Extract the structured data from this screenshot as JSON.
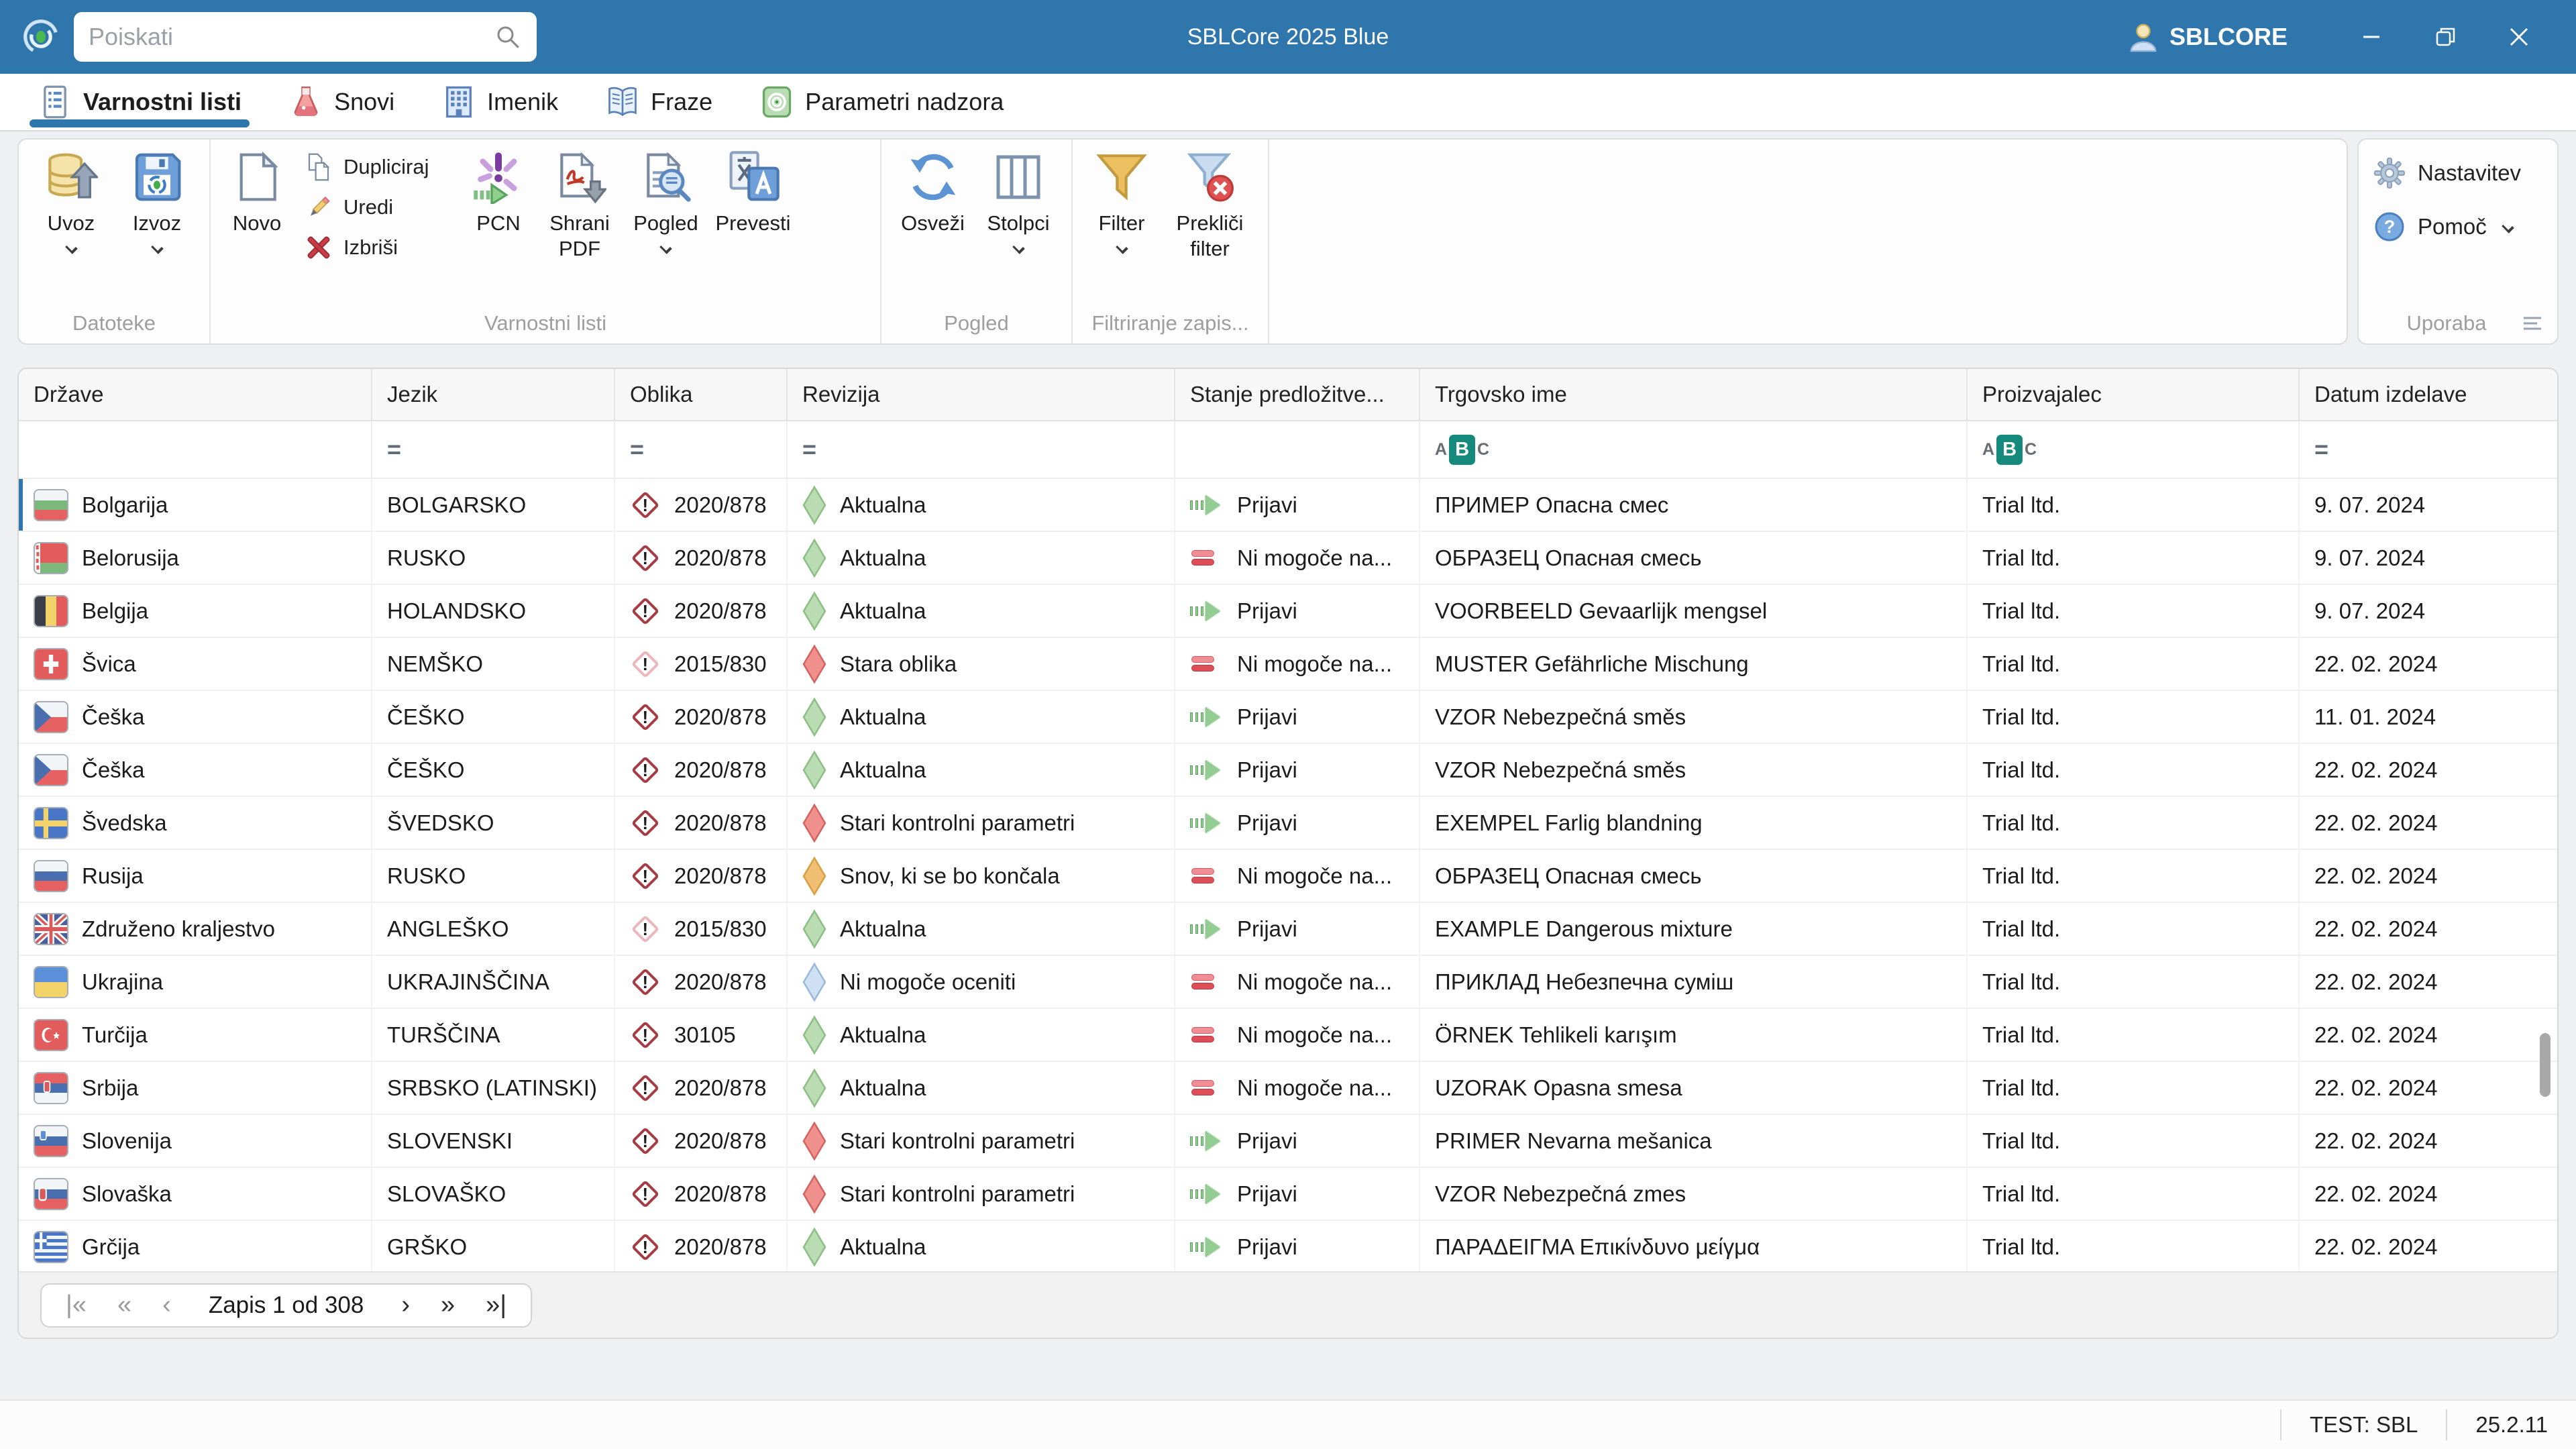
{
  "titlebar": {
    "search_placeholder": "Poiskati",
    "title": "SBLCore 2025 Blue",
    "account": "SBLCORE"
  },
  "tabs": [
    {
      "label": "Varnostni listi",
      "active": true
    },
    {
      "label": "Snovi",
      "active": false
    },
    {
      "label": "Imenik",
      "active": false
    },
    {
      "label": "Fraze",
      "active": false
    },
    {
      "label": "Parametri nadzora",
      "active": false
    }
  ],
  "ribbon": {
    "uvoz": "Uvoz",
    "izvoz": "Izvoz",
    "novo": "Novo",
    "dupliciraj": "Dupliciraj",
    "uredi": "Uredi",
    "izbrisi": "Izbriši",
    "pcn": "PCN",
    "shrani_pdf": "Shrani PDF",
    "pogled": "Pogled",
    "prevesti": "Prevesti",
    "osvezi": "Osveži",
    "stolpci": "Stolpci",
    "filter": "Filter",
    "preklici_filter": "Prekliči filter",
    "nastavitev": "Nastavitev",
    "pomoc": "Pomoč",
    "group_datoteke": "Datoteke",
    "group_varnostni": "Varnostni listi",
    "group_pogled": "Pogled",
    "group_filtriranje": "Filtriranje zapis...",
    "group_uporaba": "Uporaba"
  },
  "table": {
    "columns": [
      "Države",
      "Jezik",
      "Oblika",
      "Revizija",
      "Stanje predložitve...",
      "Trgovsko ime",
      "Proizvajalec",
      "Datum izdelave"
    ],
    "filters": [
      "",
      "eq",
      "eq",
      "eq",
      "",
      "abc",
      "abc",
      "eq"
    ],
    "filter_icons": {
      "equals": "=",
      "abc_letters": [
        "A",
        "B",
        "C"
      ]
    },
    "rows": [
      {
        "flag": "bg",
        "country": "Bolgarija",
        "jezik": "BOLGARSKO",
        "oblika": "2020/878",
        "oblika_variant": "dark",
        "revizija": "Aktualna",
        "revizija_type": "green",
        "stanje": "Prijavi",
        "stanje_type": "prijavi",
        "trgovsko": "ПРИМЕР Опасна смес",
        "proizvajalec": "Trial ltd.",
        "datum": "9. 07. 2024",
        "selected": true
      },
      {
        "flag": "by",
        "country": "Belorusija",
        "jezik": "RUSKO",
        "oblika": "2020/878",
        "oblika_variant": "dark",
        "revizija": "Aktualna",
        "revizija_type": "green",
        "stanje": "Ni mogoče na...",
        "stanje_type": "blocked",
        "trgovsko": "ОБРАЗЕЦ Опасная смесь",
        "proizvajalec": "Trial ltd.",
        "datum": "9. 07. 2024"
      },
      {
        "flag": "be",
        "country": "Belgija",
        "jezik": "HOLANDSKO",
        "oblika": "2020/878",
        "oblika_variant": "dark",
        "revizija": "Aktualna",
        "revizija_type": "green",
        "stanje": "Prijavi",
        "stanje_type": "prijavi",
        "trgovsko": "VOORBEELD Gevaarlijk mengsel",
        "proizvajalec": "Trial ltd.",
        "datum": "9. 07. 2024"
      },
      {
        "flag": "ch",
        "country": "Švica",
        "jezik": "NEMŠKO",
        "oblika": "2015/830",
        "oblika_variant": "light",
        "revizija": "Stara oblika",
        "revizija_type": "red",
        "stanje": "Ni mogoče na...",
        "stanje_type": "blocked",
        "trgovsko": "MUSTER Gefährliche Mischung",
        "proizvajalec": "Trial ltd.",
        "datum": "22. 02. 2024"
      },
      {
        "flag": "cz",
        "country": "Češka",
        "jezik": "ČEŠKO",
        "oblika": "2020/878",
        "oblika_variant": "dark",
        "revizija": "Aktualna",
        "revizija_type": "green",
        "stanje": "Prijavi",
        "stanje_type": "prijavi",
        "trgovsko": "VZOR Nebezpečná směs",
        "proizvajalec": "Trial ltd.",
        "datum": "11. 01. 2024"
      },
      {
        "flag": "cz",
        "country": "Češka",
        "jezik": "ČEŠKO",
        "oblika": "2020/878",
        "oblika_variant": "dark",
        "revizija": "Aktualna",
        "revizija_type": "green",
        "stanje": "Prijavi",
        "stanje_type": "prijavi",
        "trgovsko": "VZOR Nebezpečná směs",
        "proizvajalec": "Trial ltd.",
        "datum": "22. 02. 2024"
      },
      {
        "flag": "se",
        "country": "Švedska",
        "jezik": "ŠVEDSKO",
        "oblika": "2020/878",
        "oblika_variant": "dark",
        "revizija": "Stari kontrolni parametri",
        "revizija_type": "red",
        "stanje": "Prijavi",
        "stanje_type": "prijavi",
        "trgovsko": "EXEMPEL Farlig blandning",
        "proizvajalec": "Trial ltd.",
        "datum": "22. 02. 2024"
      },
      {
        "flag": "ru",
        "country": "Rusija",
        "jezik": "RUSKO",
        "oblika": "2020/878",
        "oblika_variant": "dark",
        "revizija": "Snov, ki se bo končala",
        "revizija_type": "orange",
        "stanje": "Ni mogoče na...",
        "stanje_type": "blocked",
        "trgovsko": "ОБРАЗЕЦ Опасная смесь",
        "proizvajalec": "Trial ltd.",
        "datum": "22. 02. 2024"
      },
      {
        "flag": "gb",
        "country": "Združeno kraljestvo",
        "jezik": "ANGLEŠKO",
        "oblika": "2015/830",
        "oblika_variant": "light",
        "revizija": "Aktualna",
        "revizija_type": "green",
        "stanje": "Prijavi",
        "stanje_type": "prijavi",
        "trgovsko": "EXAMPLE Dangerous mixture",
        "proizvajalec": "Trial ltd.",
        "datum": "22. 02. 2024"
      },
      {
        "flag": "ua",
        "country": "Ukrajina",
        "jezik": "UKRAJINŠČINA",
        "oblika": "2020/878",
        "oblika_variant": "dark",
        "revizija": "Ni mogoče oceniti",
        "revizija_type": "blue",
        "stanje": "Ni mogoče na...",
        "stanje_type": "blocked",
        "trgovsko": "ПРИКЛАД Небезпечна суміш",
        "proizvajalec": "Trial ltd.",
        "datum": "22. 02. 2024"
      },
      {
        "flag": "tr",
        "country": "Turčija",
        "jezik": "TURŠČINA",
        "oblika": "30105",
        "oblika_variant": "dark",
        "revizija": "Aktualna",
        "revizija_type": "green",
        "stanje": "Ni mogoče na...",
        "stanje_type": "blocked",
        "trgovsko": "ÖRNEK Tehlikeli karışım",
        "proizvajalec": "Trial ltd.",
        "datum": "22. 02. 2024"
      },
      {
        "flag": "rs",
        "country": "Srbija",
        "jezik": "SRBSKO (LATINSKI)",
        "oblika": "2020/878",
        "oblika_variant": "dark",
        "revizija": "Aktualna",
        "revizija_type": "green",
        "stanje": "Ni mogoče na...",
        "stanje_type": "blocked",
        "trgovsko": "UZORAK Opasna smesa",
        "proizvajalec": "Trial ltd.",
        "datum": "22. 02. 2024"
      },
      {
        "flag": "si",
        "country": "Slovenija",
        "jezik": "SLOVENSKI",
        "oblika": "2020/878",
        "oblika_variant": "dark",
        "revizija": "Stari kontrolni parametri",
        "revizija_type": "red",
        "stanje": "Prijavi",
        "stanje_type": "prijavi",
        "trgovsko": "PRIMER Nevarna mešanica",
        "proizvajalec": "Trial ltd.",
        "datum": "22. 02. 2024"
      },
      {
        "flag": "sk",
        "country": "Slovaška",
        "jezik": "SLOVAŠKO",
        "oblika": "2020/878",
        "oblika_variant": "dark",
        "revizija": "Stari kontrolni parametri",
        "revizija_type": "red",
        "stanje": "Prijavi",
        "stanje_type": "prijavi",
        "trgovsko": "VZOR Nebezpečná zmes",
        "proizvajalec": "Trial ltd.",
        "datum": "22. 02. 2024"
      },
      {
        "flag": "gr",
        "country": "Grčija",
        "jezik": "GRŠKO",
        "oblika": "2020/878",
        "oblika_variant": "dark",
        "revizija": "Aktualna",
        "revizija_type": "green",
        "stanje": "Prijavi",
        "stanje_type": "prijavi",
        "trgovsko": "ΠΑΡΑΔΕΙΓΜΑ Επικίνδυνο μείγμα",
        "proizvajalec": "Trial ltd.",
        "datum": "22. 02. 2024"
      }
    ]
  },
  "pagination": {
    "label": "Zapis 1 od 308",
    "first": "|«",
    "prev_page": "«",
    "prev": "‹",
    "next": "›",
    "next_page": "»",
    "last": "»|"
  },
  "statusbar": {
    "environment": "TEST: SBL",
    "version": "25.2.11"
  }
}
